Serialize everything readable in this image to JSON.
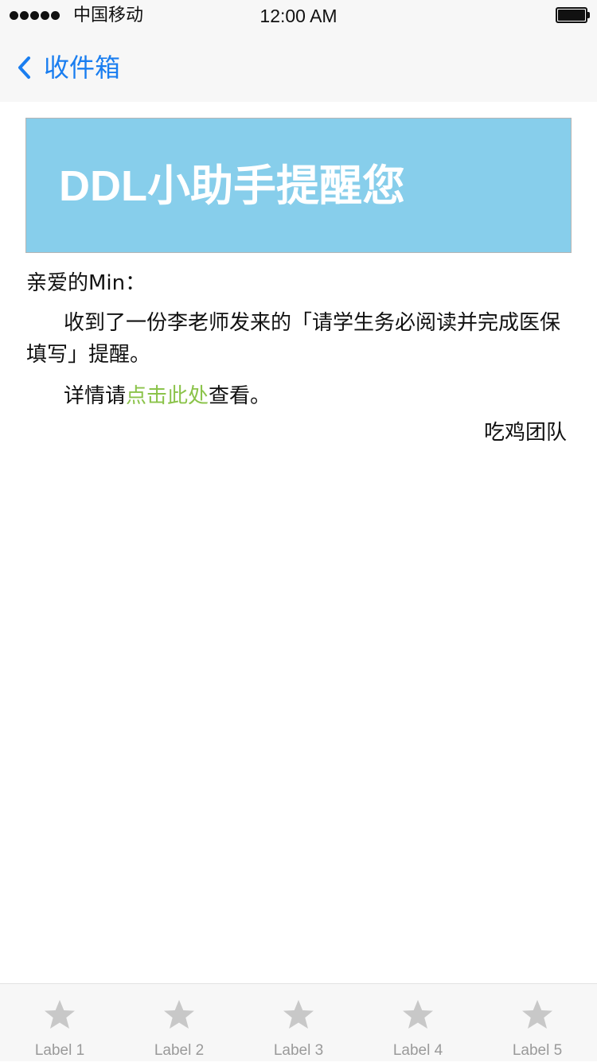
{
  "status_bar": {
    "carrier": "中国移动",
    "time": "12:00 AM"
  },
  "nav": {
    "back_label": "收件箱"
  },
  "banner": {
    "title": "DDL小助手提醒您"
  },
  "letter": {
    "greeting": "亲爱的Min：",
    "paragraph1": "收到了一份李老师发来的「请学生务必阅读并完成医保填写」提醒。",
    "paragraph2_before": "详情请",
    "paragraph2_link": "点击此处",
    "paragraph2_after": "查看。",
    "signature": "吃鸡团队"
  },
  "tabs": [
    {
      "label": "Label 1",
      "icon": "star-icon"
    },
    {
      "label": "Label 2",
      "icon": "star-icon"
    },
    {
      "label": "Label 3",
      "icon": "star-icon"
    },
    {
      "label": "Label 4",
      "icon": "star-icon"
    },
    {
      "label": "Label 5",
      "icon": "star-icon"
    }
  ],
  "colors": {
    "accent": "#1a7ef0",
    "banner_bg": "#87ceeb",
    "link": "#8bc34a",
    "tab_inactive": "#c8c8c8"
  }
}
